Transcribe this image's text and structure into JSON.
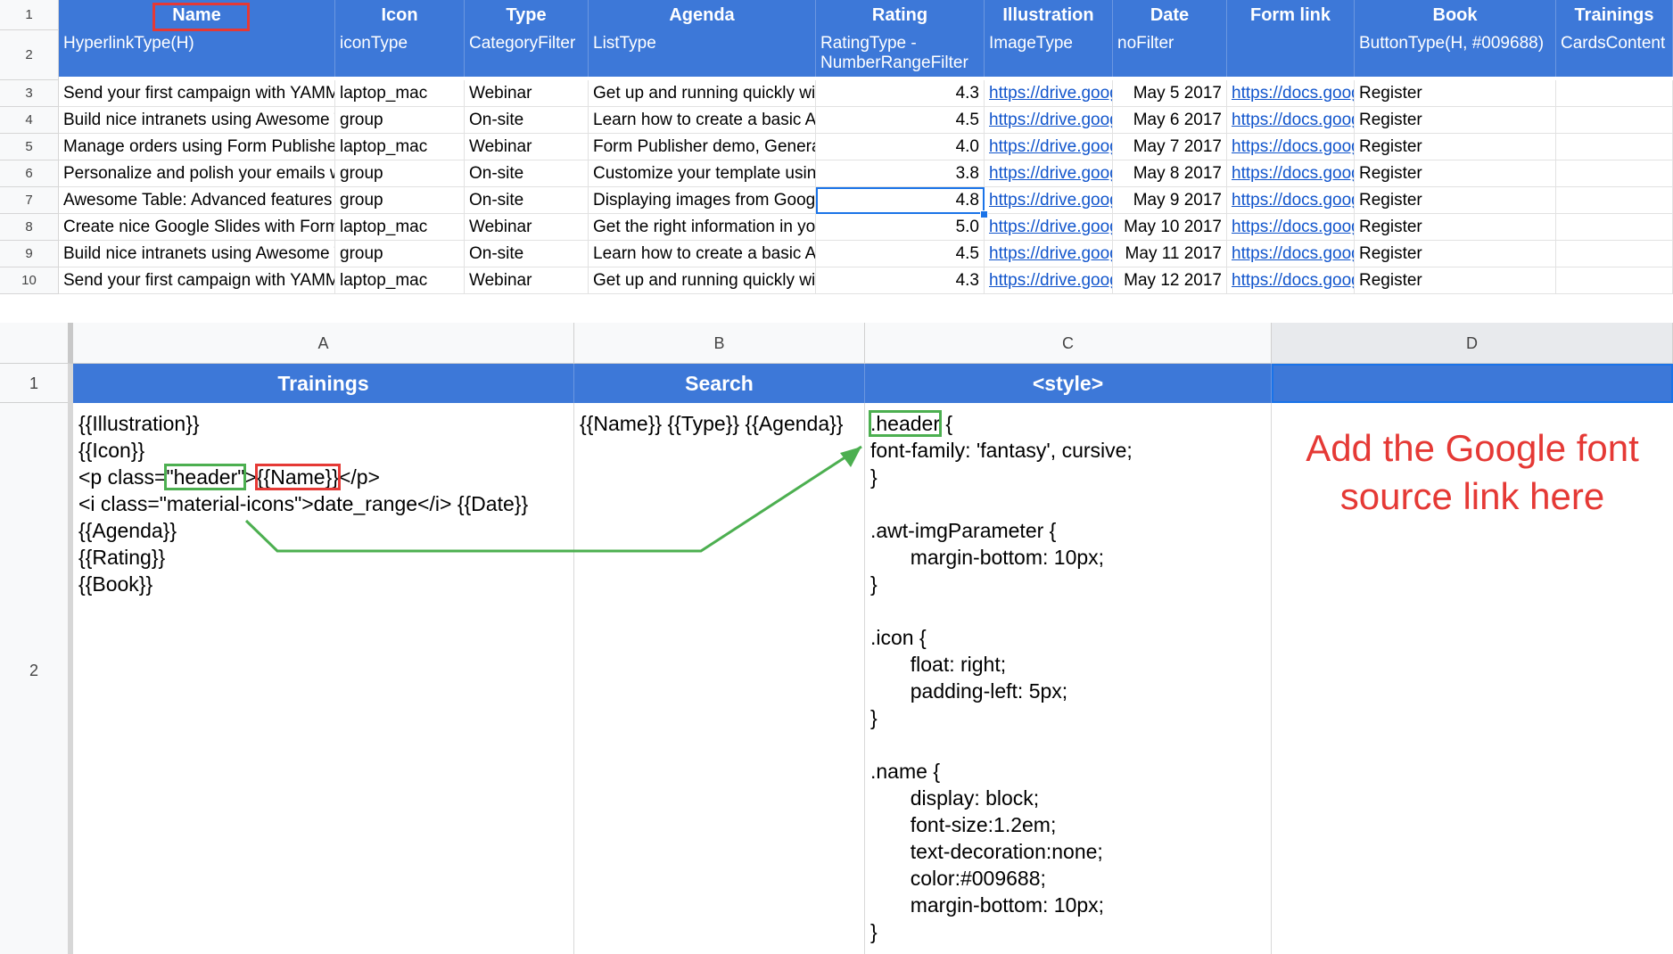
{
  "top_sheet": {
    "row_numbers": [
      "1",
      "2",
      "3",
      "4",
      "5",
      "6",
      "7",
      "8",
      "9",
      "10"
    ],
    "headers": [
      "Name",
      "Icon",
      "Type",
      "Agenda",
      "Rating",
      "Illustration",
      "Date",
      "Form link",
      "Book",
      "Trainings"
    ],
    "type_row": [
      "HyperlinkType(H)",
      "iconType",
      "CategoryFilter",
      "ListType",
      "RatingType - NumberRangeFilter",
      "ImageType",
      "noFilter",
      "",
      "ButtonType(H, #009688)",
      "CardsContent"
    ],
    "rows": [
      {
        "name": "Send your first campaign with YAMM",
        "icon": "laptop_mac",
        "type": "Webinar",
        "agenda": "Get up and running quickly with",
        "rating": "4.3",
        "illustration": "https://drive.google.com",
        "date": "May 5 2017",
        "form": "https://docs.google.com",
        "book": "Register"
      },
      {
        "name": "Build nice intranets using Awesome Table",
        "icon": "group",
        "type": "On-site",
        "agenda": "Learn how to create a basic Awesome",
        "rating": "4.5",
        "illustration": "https://drive.google.com",
        "date": "May 6 2017",
        "form": "https://docs.google.com",
        "book": "Register"
      },
      {
        "name": "Manage orders using Form Publisher",
        "icon": "laptop_mac",
        "type": "Webinar",
        "agenda": "Form Publisher demo, Generate",
        "rating": "4.0",
        "illustration": "https://drive.google.com",
        "date": "May 7 2017",
        "form": "https://docs.google.com",
        "book": "Register"
      },
      {
        "name": "Personalize and polish your emails with",
        "icon": "group",
        "type": "On-site",
        "agenda": "Customize your template using",
        "rating": "3.8",
        "illustration": "https://drive.google.com",
        "date": "May 8 2017",
        "form": "https://docs.google.com",
        "book": "Register"
      },
      {
        "name": "Awesome Table: Advanced features",
        "icon": "group",
        "type": "On-site",
        "agenda": "Displaying images from Google",
        "rating": "4.8",
        "illustration": "https://drive.google.com",
        "date": "May 9 2017",
        "form": "https://docs.google.com",
        "book": "Register"
      },
      {
        "name": "Create nice Google Slides with Form",
        "icon": "laptop_mac",
        "type": "Webinar",
        "agenda": "Get the right information in your",
        "rating": "5.0",
        "illustration": "https://drive.google.com",
        "date": "May 10 2017",
        "form": "https://docs.google.com",
        "book": "Register"
      },
      {
        "name": "Build nice intranets using Awesome Table",
        "icon": "group",
        "type": "On-site",
        "agenda": "Learn how to create a basic Awesome",
        "rating": "4.5",
        "illustration": "https://drive.google.com",
        "date": "May 11 2017",
        "form": "https://docs.google.com",
        "book": "Register"
      },
      {
        "name": "Send your first campaign with YAMM",
        "icon": "laptop_mac",
        "type": "Webinar",
        "agenda": "Get up and running quickly with",
        "rating": "4.3",
        "illustration": "https://drive.google.com",
        "date": "May 12 2017",
        "form": "https://docs.google.com",
        "book": "Register"
      }
    ]
  },
  "bottom_sheet": {
    "column_letters": [
      "A",
      "B",
      "C",
      "D"
    ],
    "row_numbers": [
      "1",
      "2"
    ],
    "headers": [
      "Trainings",
      "Search",
      "<style>",
      ""
    ],
    "cell_a_before_header": "{{Illustration}}\n{{Icon}}\n<p class=",
    "cell_a_header": "\"header\"",
    "cell_a_gt": ">",
    "cell_a_name": "{{Name}}",
    "cell_a_after_name": "</p>",
    "cell_a_rest": "<i class=\"material-icons\">date_range</i> {{Date}}\n{{Agenda}}\n{{Rating}}\n{{Book}}",
    "cell_b": "{{Name}} {{Type}} {{Agenda}}",
    "cell_c_header": ".header",
    "cell_c_brace": " {",
    "cell_c_rest": "font-family: 'fantasy', cursive;\n}\n\n.awt-imgParameter {\n       margin-bottom: 10px;\n}\n\n.icon {\n       float: right;\n       padding-left: 5px;\n}\n\n.name {\n       display: block;\n       font-size:1.2em;\n       text-decoration:none;\n       color:#009688;\n       margin-bottom: 10px;\n}",
    "annotation": "Add the Google font\nsource link here"
  },
  "colors": {
    "header_blue": "#3d78d8",
    "annotation_red": "#e53935",
    "annotation_green": "#4caf50",
    "selection_blue": "#1a73e8",
    "link_blue": "#1155cc"
  }
}
